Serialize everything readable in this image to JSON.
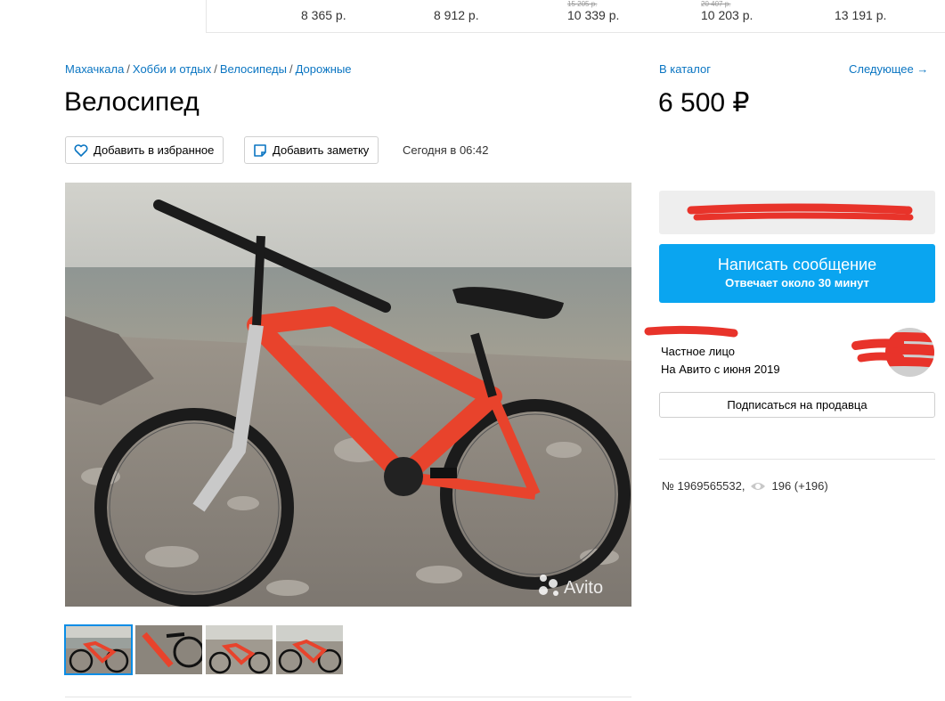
{
  "price_strip": [
    {
      "old": "",
      "price": "8 365 р."
    },
    {
      "old": "",
      "price": "8 912 р."
    },
    {
      "old": "15 205 р.",
      "price": "10 339 р."
    },
    {
      "old": "20 407 р.",
      "price": "10 203 р."
    },
    {
      "old": "",
      "price": "13 191 р."
    }
  ],
  "breadcrumbs": [
    "Махачкала",
    "Хобби и отдых",
    "Велосипеды",
    "Дорожные"
  ],
  "title": "Велосипед",
  "actions": {
    "favorite_label": "Добавить в избранное",
    "note_label": "Добавить заметку",
    "date": "Сегодня в 06:42"
  },
  "nav": {
    "catalog_label": "В каталог",
    "next_label": "Следующее →"
  },
  "price": "6 500 ₽",
  "message_button": {
    "label": "Написать сообщение",
    "sub": "Отвечает около 30 минут"
  },
  "seller": {
    "type": "Частное лицо",
    "since": "На Авито с июня 2019"
  },
  "subscribe_label": "Подписаться на продавца",
  "ad": {
    "number": "№ 1969565532,",
    "views": "196 (+196)"
  },
  "watermark": "Avito",
  "colors": {
    "link": "#0a75c2",
    "accent": "#0aa5f0",
    "bike": "#e8432c",
    "redaction": "#e8332a"
  }
}
